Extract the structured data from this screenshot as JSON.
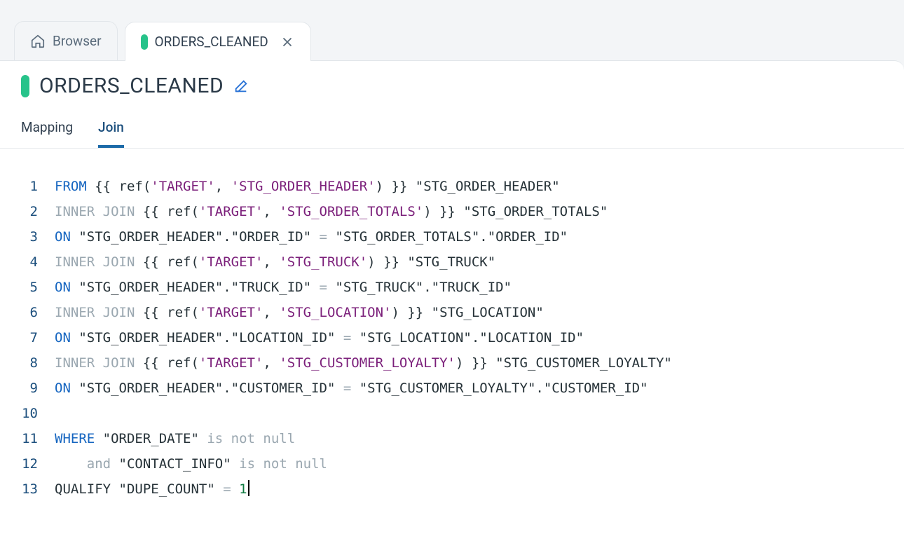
{
  "tabs": {
    "browser_label": "Browser",
    "active_label": "ORDERS_CLEANED"
  },
  "title": "ORDERS_CLEANED",
  "sub_tabs": {
    "mapping": "Mapping",
    "join": "Join"
  },
  "code": {
    "l1_from": "FROM",
    "l1_ref": " {{ ref(",
    "l1_s1": "'TARGET'",
    "l1_c": ", ",
    "l1_s2": "'STG_ORDER_HEADER'",
    "l1_end": ") }} \"STG_ORDER_HEADER\"",
    "l2_ij": "INNER JOIN",
    "l2_ref": " {{ ref(",
    "l2_s1": "'TARGET'",
    "l2_c": ", ",
    "l2_s2": "'STG_ORDER_TOTALS'",
    "l2_end": ") }} \"STG_ORDER_TOTALS\"",
    "l3_on": "ON",
    "l3_txt": " \"STG_ORDER_HEADER\".\"ORDER_ID\" ",
    "l3_eq": "=",
    "l3_txt2": " \"STG_ORDER_TOTALS\".\"ORDER_ID\"",
    "l4_ij": "INNER JOIN",
    "l4_ref": " {{ ref(",
    "l4_s1": "'TARGET'",
    "l4_c": ", ",
    "l4_s2": "'STG_TRUCK'",
    "l4_end": ") }} \"STG_TRUCK\"",
    "l5_on": "ON",
    "l5_txt": " \"STG_ORDER_HEADER\".\"TRUCK_ID\" ",
    "l5_eq": "=",
    "l5_txt2": " \"STG_TRUCK\".\"TRUCK_ID\"",
    "l6_ij": "INNER JOIN",
    "l6_ref": " {{ ref(",
    "l6_s1": "'TARGET'",
    "l6_c": ", ",
    "l6_s2": "'STG_LOCATION'",
    "l6_end": ") }} \"STG_LOCATION\"",
    "l7_on": "ON",
    "l7_txt": " \"STG_ORDER_HEADER\".\"LOCATION_ID\" ",
    "l7_eq": "=",
    "l7_txt2": " \"STG_LOCATION\".\"LOCATION_ID\"",
    "l8_ij": "INNER JOIN",
    "l8_ref": " {{ ref(",
    "l8_s1": "'TARGET'",
    "l8_c": ", ",
    "l8_s2": "'STG_CUSTOMER_LOYALTY'",
    "l8_end": ") }} \"STG_CUSTOMER_LOYALTY\"",
    "l9_on": "ON",
    "l9_txt": " \"STG_ORDER_HEADER\".\"CUSTOMER_ID\" ",
    "l9_eq": "=",
    "l9_txt2": " \"STG_CUSTOMER_LOYALTY\".\"CUSTOMER_ID\"",
    "l10": "",
    "l11_where": "WHERE",
    "l11_txt": " \"ORDER_DATE\" ",
    "l11_null": "is not null",
    "l12_pad": "    ",
    "l12_and": "and",
    "l12_txt": " \"CONTACT_INFO\" ",
    "l12_null": "is not null",
    "l13_q": "QUALIFY \"DUPE_COUNT\" ",
    "l13_eq": "=",
    "l13_sp": " ",
    "l13_num": "1"
  },
  "gutter": {
    "g1": "1",
    "g2": "2",
    "g3": "3",
    "g4": "4",
    "g5": "5",
    "g6": "6",
    "g7": "7",
    "g8": "8",
    "g9": "9",
    "g10": "10",
    "g11": "11",
    "g12": "12",
    "g13": "13"
  }
}
